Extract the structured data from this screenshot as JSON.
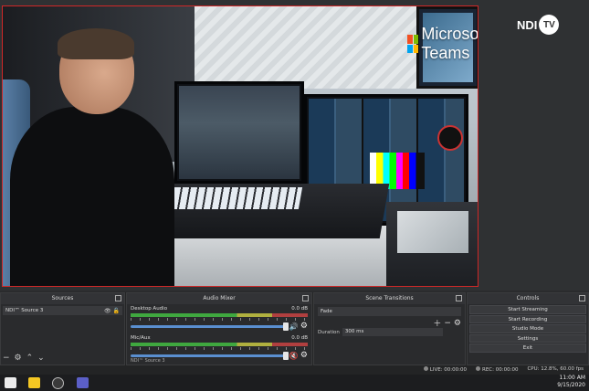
{
  "preview": {
    "overlay_brand": "Microsoft Teams",
    "ndi_label": "NDI",
    "ndi_tv": "TV"
  },
  "docks": {
    "sources": {
      "title": "Sources",
      "items": [
        "NDI™ Source 3"
      ]
    },
    "audio_mixer": {
      "title": "Audio Mixer",
      "channels": [
        {
          "name": "Desktop Audio",
          "db": "0.0 dB",
          "muted": false
        },
        {
          "name": "Mic/Aux",
          "db": "0.0 dB",
          "muted": true
        }
      ],
      "third_channel": "NDI™ Source 3"
    },
    "scene_transitions": {
      "title": "Scene Transitions",
      "selected": "Fade",
      "duration_label": "Duration",
      "duration_value": "300 ms"
    },
    "controls": {
      "title": "Controls",
      "buttons": [
        "Start Streaming",
        "Start Recording",
        "Studio Mode",
        "Settings",
        "Exit"
      ]
    }
  },
  "status": {
    "live": "LIVE: 00:00:00",
    "rec": "REC: 00:00:00",
    "cpu": "CPU: 12.8%, 60.00 fps"
  },
  "taskbar": {
    "time": "11:00 AM",
    "date": "9/15/2020"
  },
  "colors": {
    "preview_border": "#d02828",
    "volume_track": "#5a8fd0",
    "muted": "#e03838"
  }
}
